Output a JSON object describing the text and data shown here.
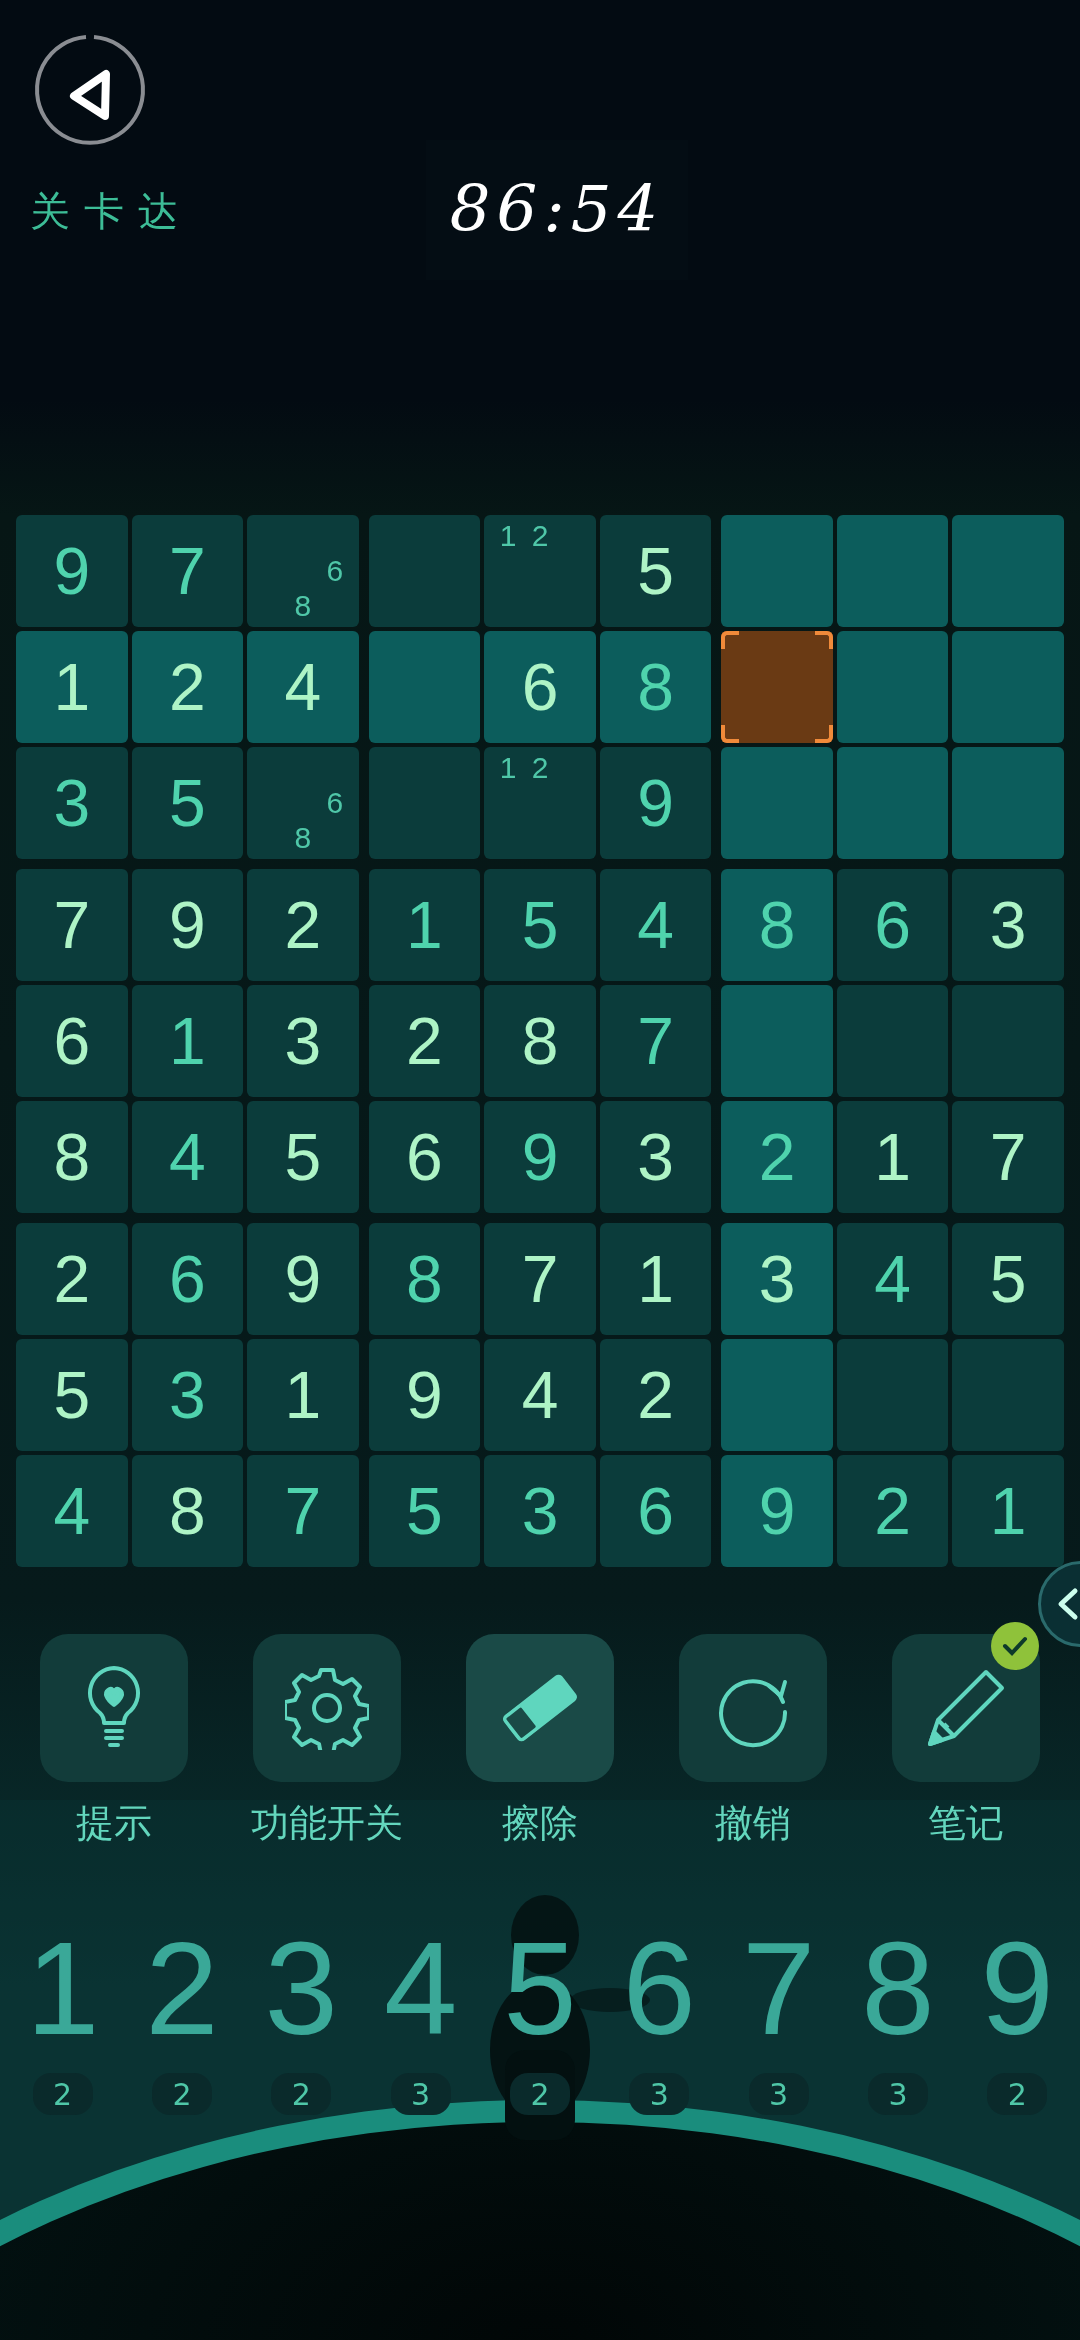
{
  "header": {
    "level_label": "关卡达",
    "timer": "86:54"
  },
  "grid": {
    "rows": [
      {
        "cells": [
          {
            "value": "9",
            "given": true,
            "highlighted": false,
            "selected": false
          },
          {
            "value": "7",
            "given": true,
            "highlighted": false,
            "selected": false
          },
          {
            "notes": [
              "6",
              "8"
            ],
            "highlighted": false,
            "selected": false
          },
          {
            "highlighted": false,
            "selected": false
          },
          {
            "notes": [
              "1",
              "2"
            ],
            "highlighted": false,
            "selected": false
          },
          {
            "value": "5",
            "given": false,
            "highlighted": false,
            "selected": false
          },
          {
            "highlighted": true,
            "selected": false
          },
          {
            "highlighted": true,
            "selected": false
          },
          {
            "highlighted": true,
            "selected": false
          }
        ]
      },
      {
        "cells": [
          {
            "value": "1",
            "given": false,
            "highlighted": true,
            "selected": false
          },
          {
            "value": "2",
            "given": false,
            "highlighted": true,
            "selected": false
          },
          {
            "value": "4",
            "given": false,
            "highlighted": true,
            "selected": false
          },
          {
            "highlighted": true,
            "selected": false
          },
          {
            "value": "6",
            "given": false,
            "highlighted": true,
            "selected": false
          },
          {
            "value": "8",
            "given": true,
            "highlighted": true,
            "selected": false
          },
          {
            "highlighted": true,
            "selected": true
          },
          {
            "highlighted": true,
            "selected": false
          },
          {
            "highlighted": true,
            "selected": false
          }
        ]
      },
      {
        "cells": [
          {
            "value": "3",
            "given": true,
            "highlighted": false,
            "selected": false
          },
          {
            "value": "5",
            "given": true,
            "highlighted": false,
            "selected": false
          },
          {
            "notes": [
              "6",
              "8"
            ],
            "highlighted": false,
            "selected": false
          },
          {
            "highlighted": false,
            "selected": false
          },
          {
            "notes": [
              "1",
              "2"
            ],
            "highlighted": false,
            "selected": false
          },
          {
            "value": "9",
            "given": true,
            "highlighted": false,
            "selected": false
          },
          {
            "highlighted": true,
            "selected": false
          },
          {
            "highlighted": true,
            "selected": false
          },
          {
            "highlighted": true,
            "selected": false
          }
        ]
      },
      {
        "cells": [
          {
            "value": "7",
            "given": false,
            "highlighted": false,
            "selected": false
          },
          {
            "value": "9",
            "given": false,
            "highlighted": false,
            "selected": false
          },
          {
            "value": "2",
            "given": false,
            "highlighted": false,
            "selected": false
          },
          {
            "value": "1",
            "given": true,
            "highlighted": false,
            "selected": false
          },
          {
            "value": "5",
            "given": true,
            "highlighted": false,
            "selected": false
          },
          {
            "value": "4",
            "given": true,
            "highlighted": false,
            "selected": false
          },
          {
            "value": "8",
            "given": true,
            "highlighted": true,
            "selected": false
          },
          {
            "value": "6",
            "given": true,
            "highlighted": false,
            "selected": false
          },
          {
            "value": "3",
            "given": false,
            "highlighted": false,
            "selected": false
          }
        ]
      },
      {
        "cells": [
          {
            "value": "6",
            "given": false,
            "highlighted": false,
            "selected": false
          },
          {
            "value": "1",
            "given": true,
            "highlighted": false,
            "selected": false
          },
          {
            "value": "3",
            "given": false,
            "highlighted": false,
            "selected": false
          },
          {
            "value": "2",
            "given": false,
            "highlighted": false,
            "selected": false
          },
          {
            "value": "8",
            "given": false,
            "highlighted": false,
            "selected": false
          },
          {
            "value": "7",
            "given": true,
            "highlighted": false,
            "selected": false
          },
          {
            "highlighted": true,
            "selected": false
          },
          {
            "highlighted": false,
            "selected": false
          },
          {
            "highlighted": false,
            "selected": false
          }
        ]
      },
      {
        "cells": [
          {
            "value": "8",
            "given": false,
            "highlighted": false,
            "selected": false
          },
          {
            "value": "4",
            "given": true,
            "highlighted": false,
            "selected": false
          },
          {
            "value": "5",
            "given": false,
            "highlighted": false,
            "selected": false
          },
          {
            "value": "6",
            "given": false,
            "highlighted": false,
            "selected": false
          },
          {
            "value": "9",
            "given": true,
            "highlighted": false,
            "selected": false
          },
          {
            "value": "3",
            "given": false,
            "highlighted": false,
            "selected": false
          },
          {
            "value": "2",
            "given": true,
            "highlighted": true,
            "selected": false
          },
          {
            "value": "1",
            "given": false,
            "highlighted": false,
            "selected": false
          },
          {
            "value": "7",
            "given": false,
            "highlighted": false,
            "selected": false
          }
        ]
      },
      {
        "cells": [
          {
            "value": "2",
            "given": false,
            "highlighted": false,
            "selected": false
          },
          {
            "value": "6",
            "given": true,
            "highlighted": false,
            "selected": false
          },
          {
            "value": "9",
            "given": false,
            "highlighted": false,
            "selected": false
          },
          {
            "value": "8",
            "given": true,
            "highlighted": false,
            "selected": false
          },
          {
            "value": "7",
            "given": false,
            "highlighted": false,
            "selected": false
          },
          {
            "value": "1",
            "given": false,
            "highlighted": false,
            "selected": false
          },
          {
            "value": "3",
            "given": false,
            "highlighted": true,
            "selected": false
          },
          {
            "value": "4",
            "given": true,
            "highlighted": false,
            "selected": false
          },
          {
            "value": "5",
            "given": false,
            "highlighted": false,
            "selected": false
          }
        ]
      },
      {
        "cells": [
          {
            "value": "5",
            "given": false,
            "highlighted": false,
            "selected": false
          },
          {
            "value": "3",
            "given": true,
            "highlighted": false,
            "selected": false
          },
          {
            "value": "1",
            "given": false,
            "highlighted": false,
            "selected": false
          },
          {
            "value": "9",
            "given": false,
            "highlighted": false,
            "selected": false
          },
          {
            "value": "4",
            "given": false,
            "highlighted": false,
            "selected": false
          },
          {
            "value": "2",
            "given": false,
            "highlighted": false,
            "selected": false
          },
          {
            "highlighted": true,
            "selected": false
          },
          {
            "highlighted": false,
            "selected": false
          },
          {
            "highlighted": false,
            "selected": false
          }
        ]
      },
      {
        "cells": [
          {
            "value": "4",
            "given": true,
            "highlighted": false,
            "selected": false
          },
          {
            "value": "8",
            "given": false,
            "highlighted": false,
            "selected": false
          },
          {
            "value": "7",
            "given": true,
            "highlighted": false,
            "selected": false
          },
          {
            "value": "5",
            "given": true,
            "highlighted": false,
            "selected": false
          },
          {
            "value": "3",
            "given": true,
            "highlighted": false,
            "selected": false
          },
          {
            "value": "6",
            "given": true,
            "highlighted": false,
            "selected": false
          },
          {
            "value": "9",
            "given": true,
            "highlighted": true,
            "selected": false
          },
          {
            "value": "2",
            "given": true,
            "highlighted": false,
            "selected": false
          },
          {
            "value": "1",
            "given": true,
            "highlighted": false,
            "selected": false
          }
        ]
      }
    ]
  },
  "tools": [
    {
      "kind": "hint",
      "label": "提示"
    },
    {
      "kind": "settings",
      "label": "功能开关"
    },
    {
      "kind": "erase",
      "label": "擦除"
    },
    {
      "kind": "undo",
      "label": "撤销"
    },
    {
      "kind": "notes",
      "label": "笔记",
      "on": true
    }
  ],
  "number_pad": [
    {
      "digit": "1",
      "count": "2"
    },
    {
      "digit": "2",
      "count": "2"
    },
    {
      "digit": "3",
      "count": "2"
    },
    {
      "digit": "4",
      "count": "3"
    },
    {
      "digit": "5",
      "count": "2"
    },
    {
      "digit": "6",
      "count": "3"
    },
    {
      "digit": "7",
      "count": "3"
    },
    {
      "digit": "8",
      "count": "3"
    },
    {
      "digit": "9",
      "count": "2"
    }
  ]
}
